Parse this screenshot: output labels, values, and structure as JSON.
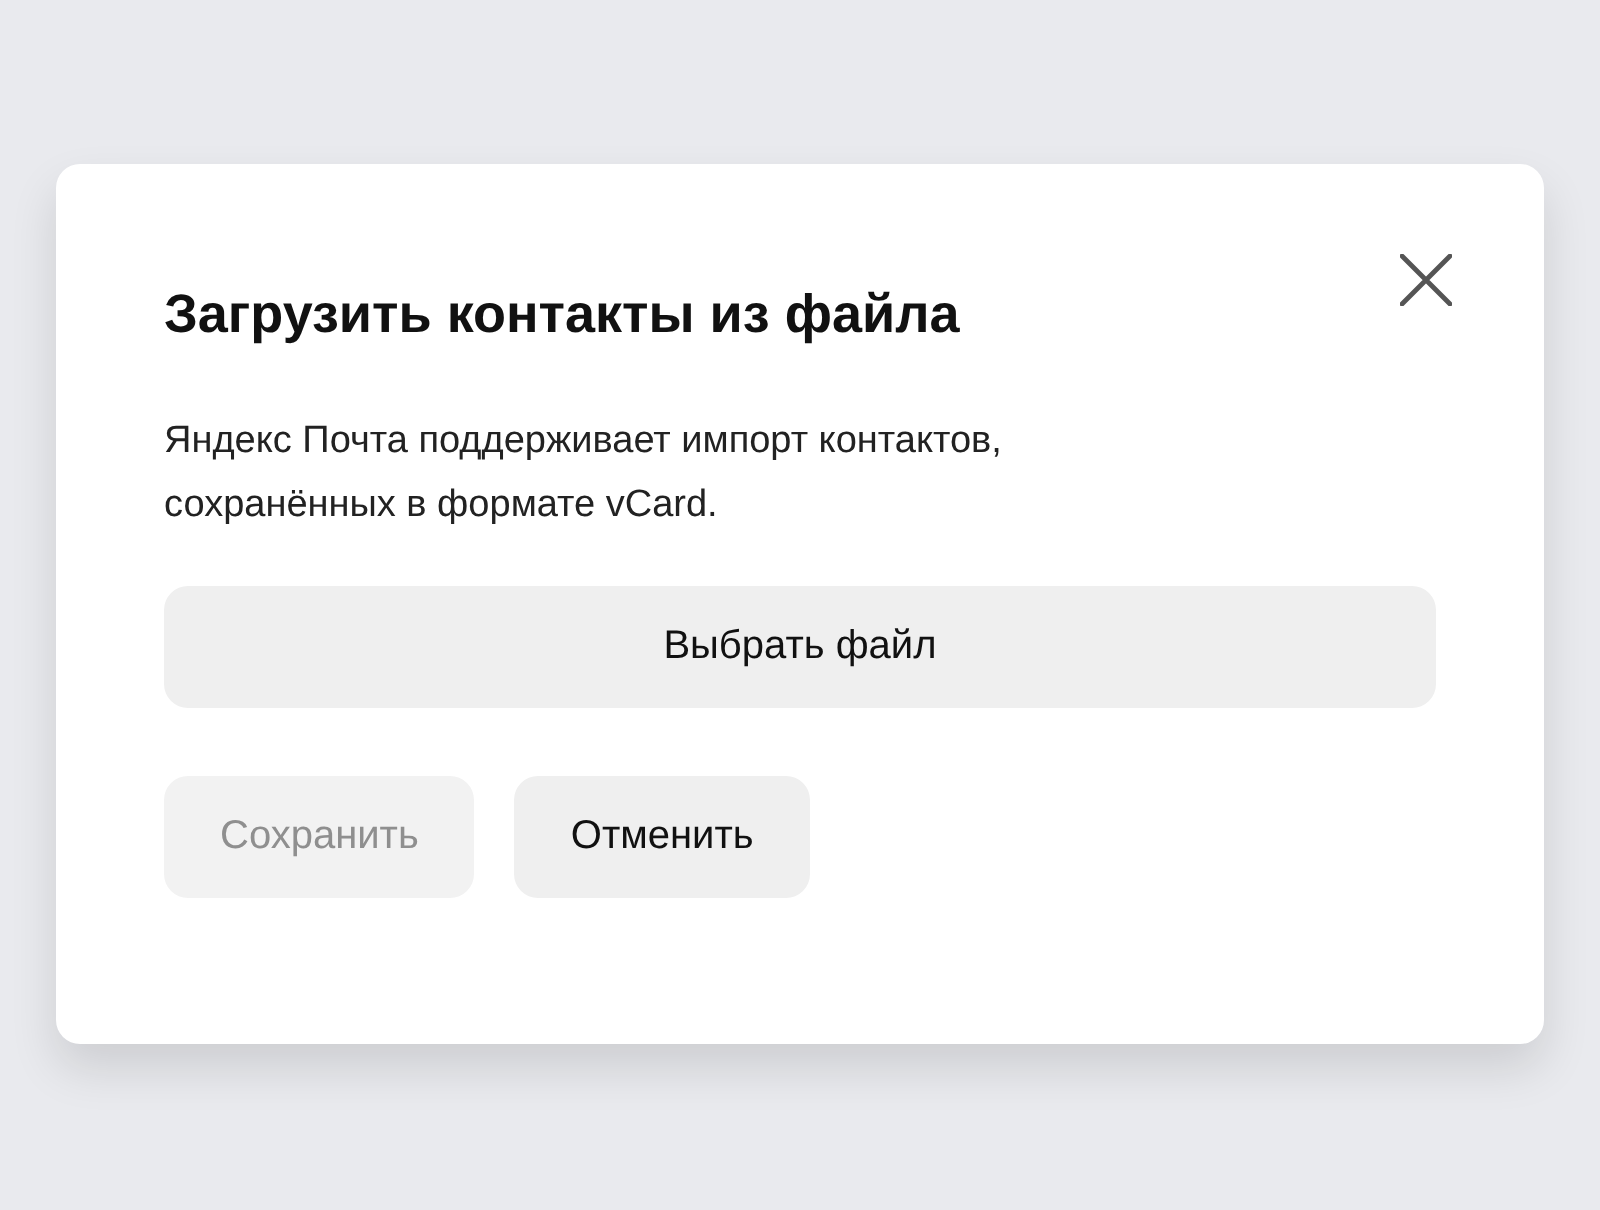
{
  "dialog": {
    "title": "Загрузить контакты из файла",
    "description": "Яндекс Почта поддерживает импорт контактов, сохранённых в формате vCard.",
    "choose_file_button": "Выбрать файл",
    "buttons": [
      {
        "label": "Сохранить",
        "disabled": true
      },
      {
        "label": "Отменить",
        "disabled": false
      }
    ]
  }
}
